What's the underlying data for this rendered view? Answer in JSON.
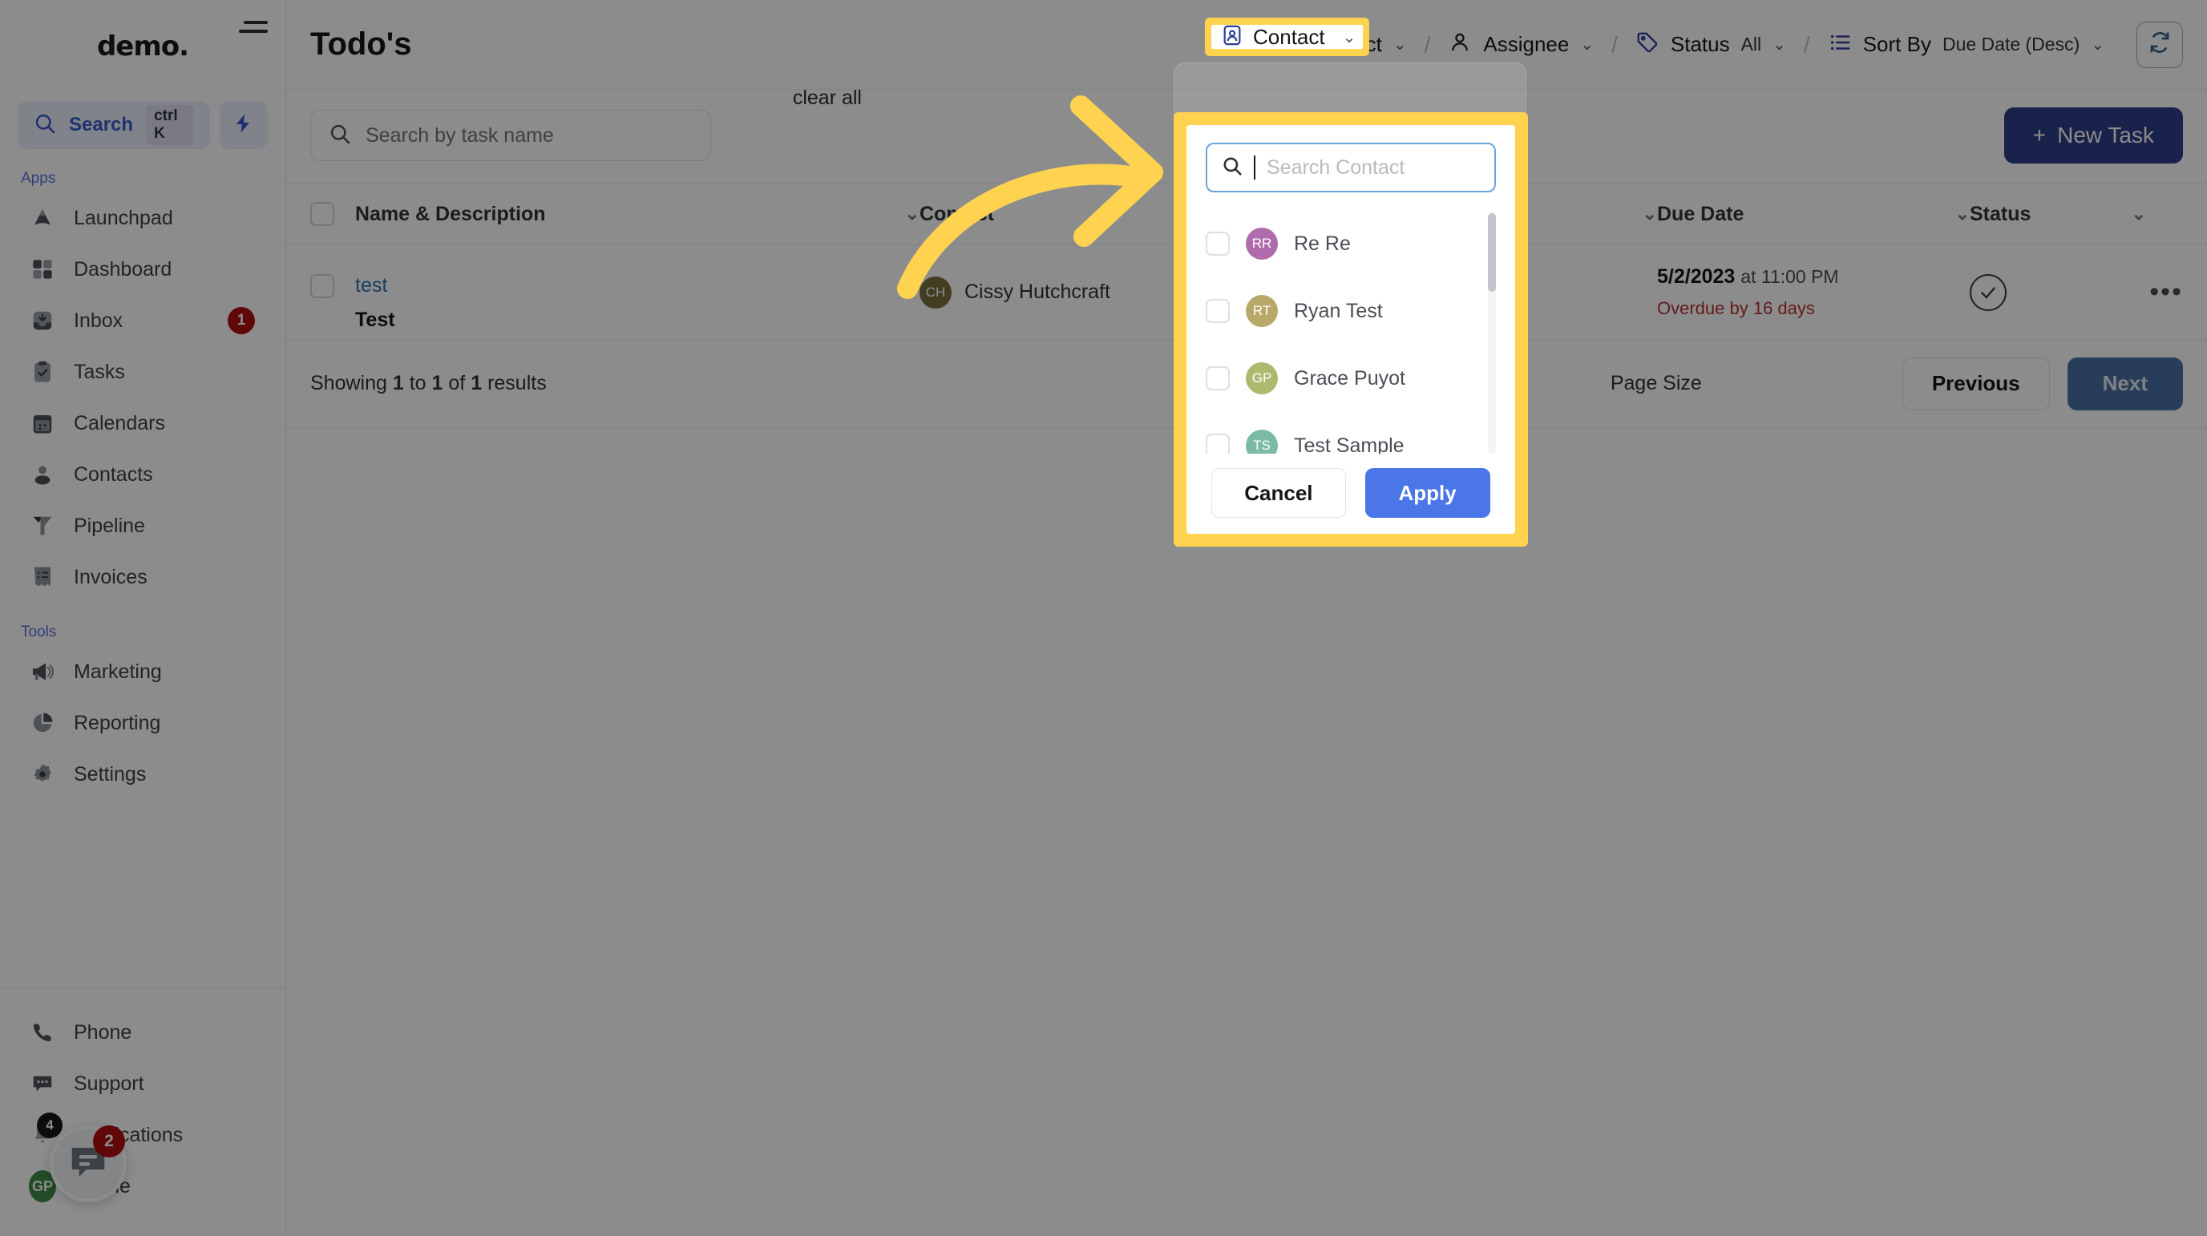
{
  "brand": {
    "name": "demo",
    "suffix": "."
  },
  "sidebar": {
    "search": {
      "label": "Search",
      "shortcut": "ctrl K"
    },
    "section_apps": "Apps",
    "section_tools": "Tools",
    "apps": [
      {
        "label": "Launchpad",
        "icon": "launchpad-icon",
        "badge": ""
      },
      {
        "label": "Dashboard",
        "icon": "grid-icon",
        "badge": ""
      },
      {
        "label": "Inbox",
        "icon": "inbox-icon",
        "badge": "1"
      },
      {
        "label": "Tasks",
        "icon": "clipboard-check-icon",
        "badge": ""
      },
      {
        "label": "Calendars",
        "icon": "calendar-icon",
        "badge": ""
      },
      {
        "label": "Contacts",
        "icon": "person-icon",
        "badge": ""
      },
      {
        "label": "Pipeline",
        "icon": "funnel-icon",
        "badge": ""
      },
      {
        "label": "Invoices",
        "icon": "invoice-icon",
        "badge": ""
      }
    ],
    "tools": [
      {
        "label": "Marketing",
        "icon": "megaphone-icon",
        "badge": ""
      },
      {
        "label": "Reporting",
        "icon": "pie-chart-icon",
        "badge": ""
      },
      {
        "label": "Settings",
        "icon": "gear-icon",
        "badge": ""
      }
    ],
    "bottom": [
      {
        "label": "Phone",
        "icon": "phone-icon",
        "badge": ""
      },
      {
        "label": "Support",
        "icon": "chat-dots-icon",
        "badge": ""
      },
      {
        "label": "Notifications",
        "icon": "bell-icon",
        "badge": "4"
      },
      {
        "label": "Profile",
        "icon": "avatar",
        "badge": "",
        "initials": "GP"
      }
    ],
    "chat_widget_badge": "2"
  },
  "header": {
    "title": "Todo's",
    "filters": [
      {
        "name": "contact",
        "label": "Contact",
        "value": "",
        "icon": "contact-card-icon"
      },
      {
        "name": "assignee",
        "label": "Assignee",
        "value": "",
        "icon": "person-icon"
      },
      {
        "name": "status",
        "label": "Status",
        "value": "All",
        "icon": "tag-icon"
      },
      {
        "name": "sort_by",
        "label": "Sort By",
        "value": "Due Date (Desc)",
        "icon": "list-icon"
      }
    ],
    "separator": "/",
    "refresh_icon": "refresh-icon"
  },
  "toolbar": {
    "search_placeholder": "Search by task name",
    "new_task_label": "New Task",
    "plus": "+"
  },
  "table": {
    "columns": [
      {
        "key": "name",
        "label": "Name & Description"
      },
      {
        "key": "contact",
        "label": "Contact"
      },
      {
        "key": "assignee",
        "label": ""
      },
      {
        "key": "due",
        "label": "Due Date"
      },
      {
        "key": "status",
        "label": "Status"
      }
    ],
    "rows": [
      {
        "name": "test",
        "description": "Test",
        "contact_initials": "CH",
        "contact_name": "Cissy Hutchcraft",
        "contact_color": "#7a6f3e",
        "due_date": "5/2/2023",
        "due_time": "at 11:00 PM",
        "overdue": "Overdue by 16 days",
        "status_icon": "check-circle-icon",
        "actions_icon": "more-horizontal-icon"
      }
    ]
  },
  "footer": {
    "showing_prefix": "Showing",
    "showing_from": "1",
    "showing_mid": "to",
    "showing_to": "1",
    "showing_of": "of",
    "showing_total": "1",
    "showing_suffix": "results",
    "showing_text": "Showing 1 to 1 of 1 results",
    "page_size_label": "Page Size",
    "previous_label": "Previous",
    "next_label": "Next"
  },
  "dropdown": {
    "clear_all_label": "clear all",
    "search_placeholder": "Search Contact",
    "search_value": "",
    "cancel_label": "Cancel",
    "apply_label": "Apply",
    "contacts": [
      {
        "initials": "RR",
        "name": "Re Re",
        "color": "#b06bad",
        "checked": false
      },
      {
        "initials": "RT",
        "name": "Ryan Test",
        "color": "#b8a86a",
        "checked": false
      },
      {
        "initials": "GP",
        "name": "Grace Puyot",
        "color": "#adb96e",
        "checked": false
      },
      {
        "initials": "TS",
        "name": "Test Sample",
        "color": "#7cbba3",
        "checked": false
      }
    ]
  },
  "annotation": {
    "highlight_color": "#ffd34f",
    "arrow_color": "#ffd34f"
  },
  "colors": {
    "primary_blue": "#2e3f87",
    "apply_blue": "#4a76e8",
    "accent": "#3a5ccc",
    "danger": "#b00d0d",
    "overdue": "#b43232"
  }
}
